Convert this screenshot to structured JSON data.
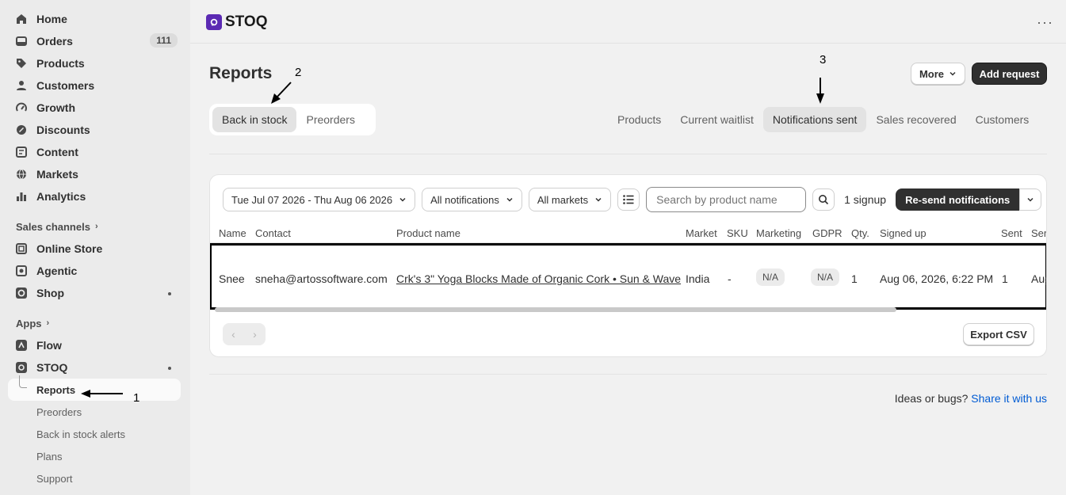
{
  "sidebar": {
    "items": [
      {
        "label": "Home",
        "icon": "home-icon"
      },
      {
        "label": "Orders",
        "icon": "inbox-icon",
        "badge": "111"
      },
      {
        "label": "Products",
        "icon": "tag-icon"
      },
      {
        "label": "Customers",
        "icon": "person-icon"
      },
      {
        "label": "Growth",
        "icon": "gauge-icon"
      },
      {
        "label": "Discounts",
        "icon": "discount-icon"
      },
      {
        "label": "Content",
        "icon": "content-icon"
      },
      {
        "label": "Markets",
        "icon": "globe-icon"
      },
      {
        "label": "Analytics",
        "icon": "bar-chart-icon"
      }
    ],
    "sales_channels_label": "Sales channels",
    "channels": [
      {
        "label": "Online Store",
        "icon": "store-icon"
      },
      {
        "label": "Agentic",
        "icon": "robot-icon"
      },
      {
        "label": "Shop",
        "icon": "shop-icon"
      }
    ],
    "apps_label": "Apps",
    "apps": [
      {
        "label": "Flow",
        "icon": "flow-icon"
      },
      {
        "label": "STOQ",
        "icon": "stoq-icon"
      }
    ],
    "stoq_sub": [
      "Reports",
      "Preorders",
      "Back in stock alerts",
      "Plans",
      "Support"
    ]
  },
  "header": {
    "app_name": "STOQ",
    "menu_glyph": "···"
  },
  "page": {
    "title": "Reports",
    "more_label": "More",
    "add_request_label": "Add request",
    "segments": [
      "Back in stock",
      "Preorders"
    ],
    "tabs": [
      "Products",
      "Current waitlist",
      "Notifications sent",
      "Sales recovered",
      "Customers"
    ]
  },
  "filters": {
    "date_range": "Tue Jul 07 2026 - Thu Aug 06 2026",
    "notifications": "All notifications",
    "markets": "All markets",
    "search_placeholder": "Search by product name",
    "signup_count": "1 signup",
    "resend_label": "Re-send notifications"
  },
  "table": {
    "headers": [
      "Name",
      "Contact",
      "Product name",
      "Market",
      "SKU",
      "Marketing",
      "GDPR",
      "Qty.",
      "Signed up",
      "Sent",
      "Ser"
    ],
    "row": {
      "name": "Snee",
      "contact": "sneha@artossoftware.com",
      "product": "Crk's 3\" Yoga Blocks Made of Organic Cork • Sun & Wave",
      "market": "India",
      "sku": "-",
      "marketing": "N/A",
      "gdpr": "N/A",
      "qty": "1",
      "signed_up": "Aug 06, 2026, 6:22 PM",
      "sent": "1",
      "sent_at": "Aug"
    }
  },
  "pager": {
    "prev": "‹",
    "next": "›"
  },
  "export_label": "Export CSV",
  "footer": {
    "text": "Ideas or bugs?",
    "link": "Share it with us"
  },
  "annotations": {
    "one": "1",
    "two": "2",
    "three": "3"
  },
  "colors": {
    "accent_dark": "#303030",
    "stoq_purple": "#5b2ab3",
    "link_blue": "#005bd3"
  }
}
